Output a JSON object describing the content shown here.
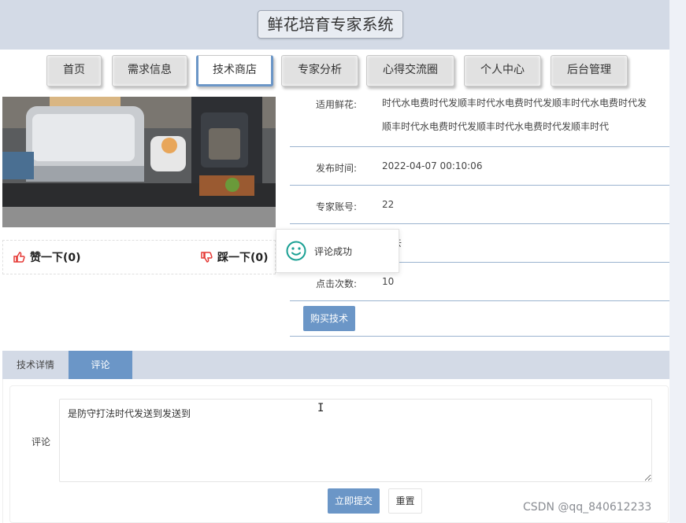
{
  "site": {
    "title": "鲜花培育专家系统"
  },
  "nav": {
    "items": [
      {
        "label": "首页"
      },
      {
        "label": "需求信息"
      },
      {
        "label": "技术商店"
      },
      {
        "label": "专家分析"
      },
      {
        "label": "心得交流圈"
      },
      {
        "label": "个人中心"
      },
      {
        "label": "后台管理"
      }
    ],
    "active_index": 2
  },
  "product": {
    "image_alt": "kitchen-appliances-photo"
  },
  "votes": {
    "like_label": "赞一下(0)",
    "dislike_label": "踩一下(0)"
  },
  "details": {
    "suitable_label": "适用鲜花:",
    "suitable_value_line1": "时代水电费时代发顺丰时代水电费时代发顺丰时代水电费时代发",
    "suitable_value_line2": "顺丰时代水电费时代发顺丰时代水电费时代发顺丰时代",
    "publish_time_label": "发布时间:",
    "publish_time_value": "2022-04-07 00:10:06",
    "expert_account_label": "专家账号:",
    "expert_account_value": "22",
    "hidden_row_partial": "去",
    "click_count_label": "点击次数:",
    "click_count_value": "10",
    "buy_button": "购买技术"
  },
  "toast": {
    "message": "评论成功"
  },
  "tabs": {
    "items": [
      {
        "label": "技术详情"
      },
      {
        "label": "评论"
      }
    ],
    "active_index": 1
  },
  "comment": {
    "label": "评论",
    "value": "是防守打法时代发送到发送到",
    "submit": "立即提交",
    "reset": "重置"
  },
  "watermark": "CSDN @qq_840612233",
  "colors": {
    "accent": "#6b96c7",
    "header_bg": "#d3dae6",
    "toast_icon": "#1aa094",
    "vote_icon": "#e53935"
  }
}
